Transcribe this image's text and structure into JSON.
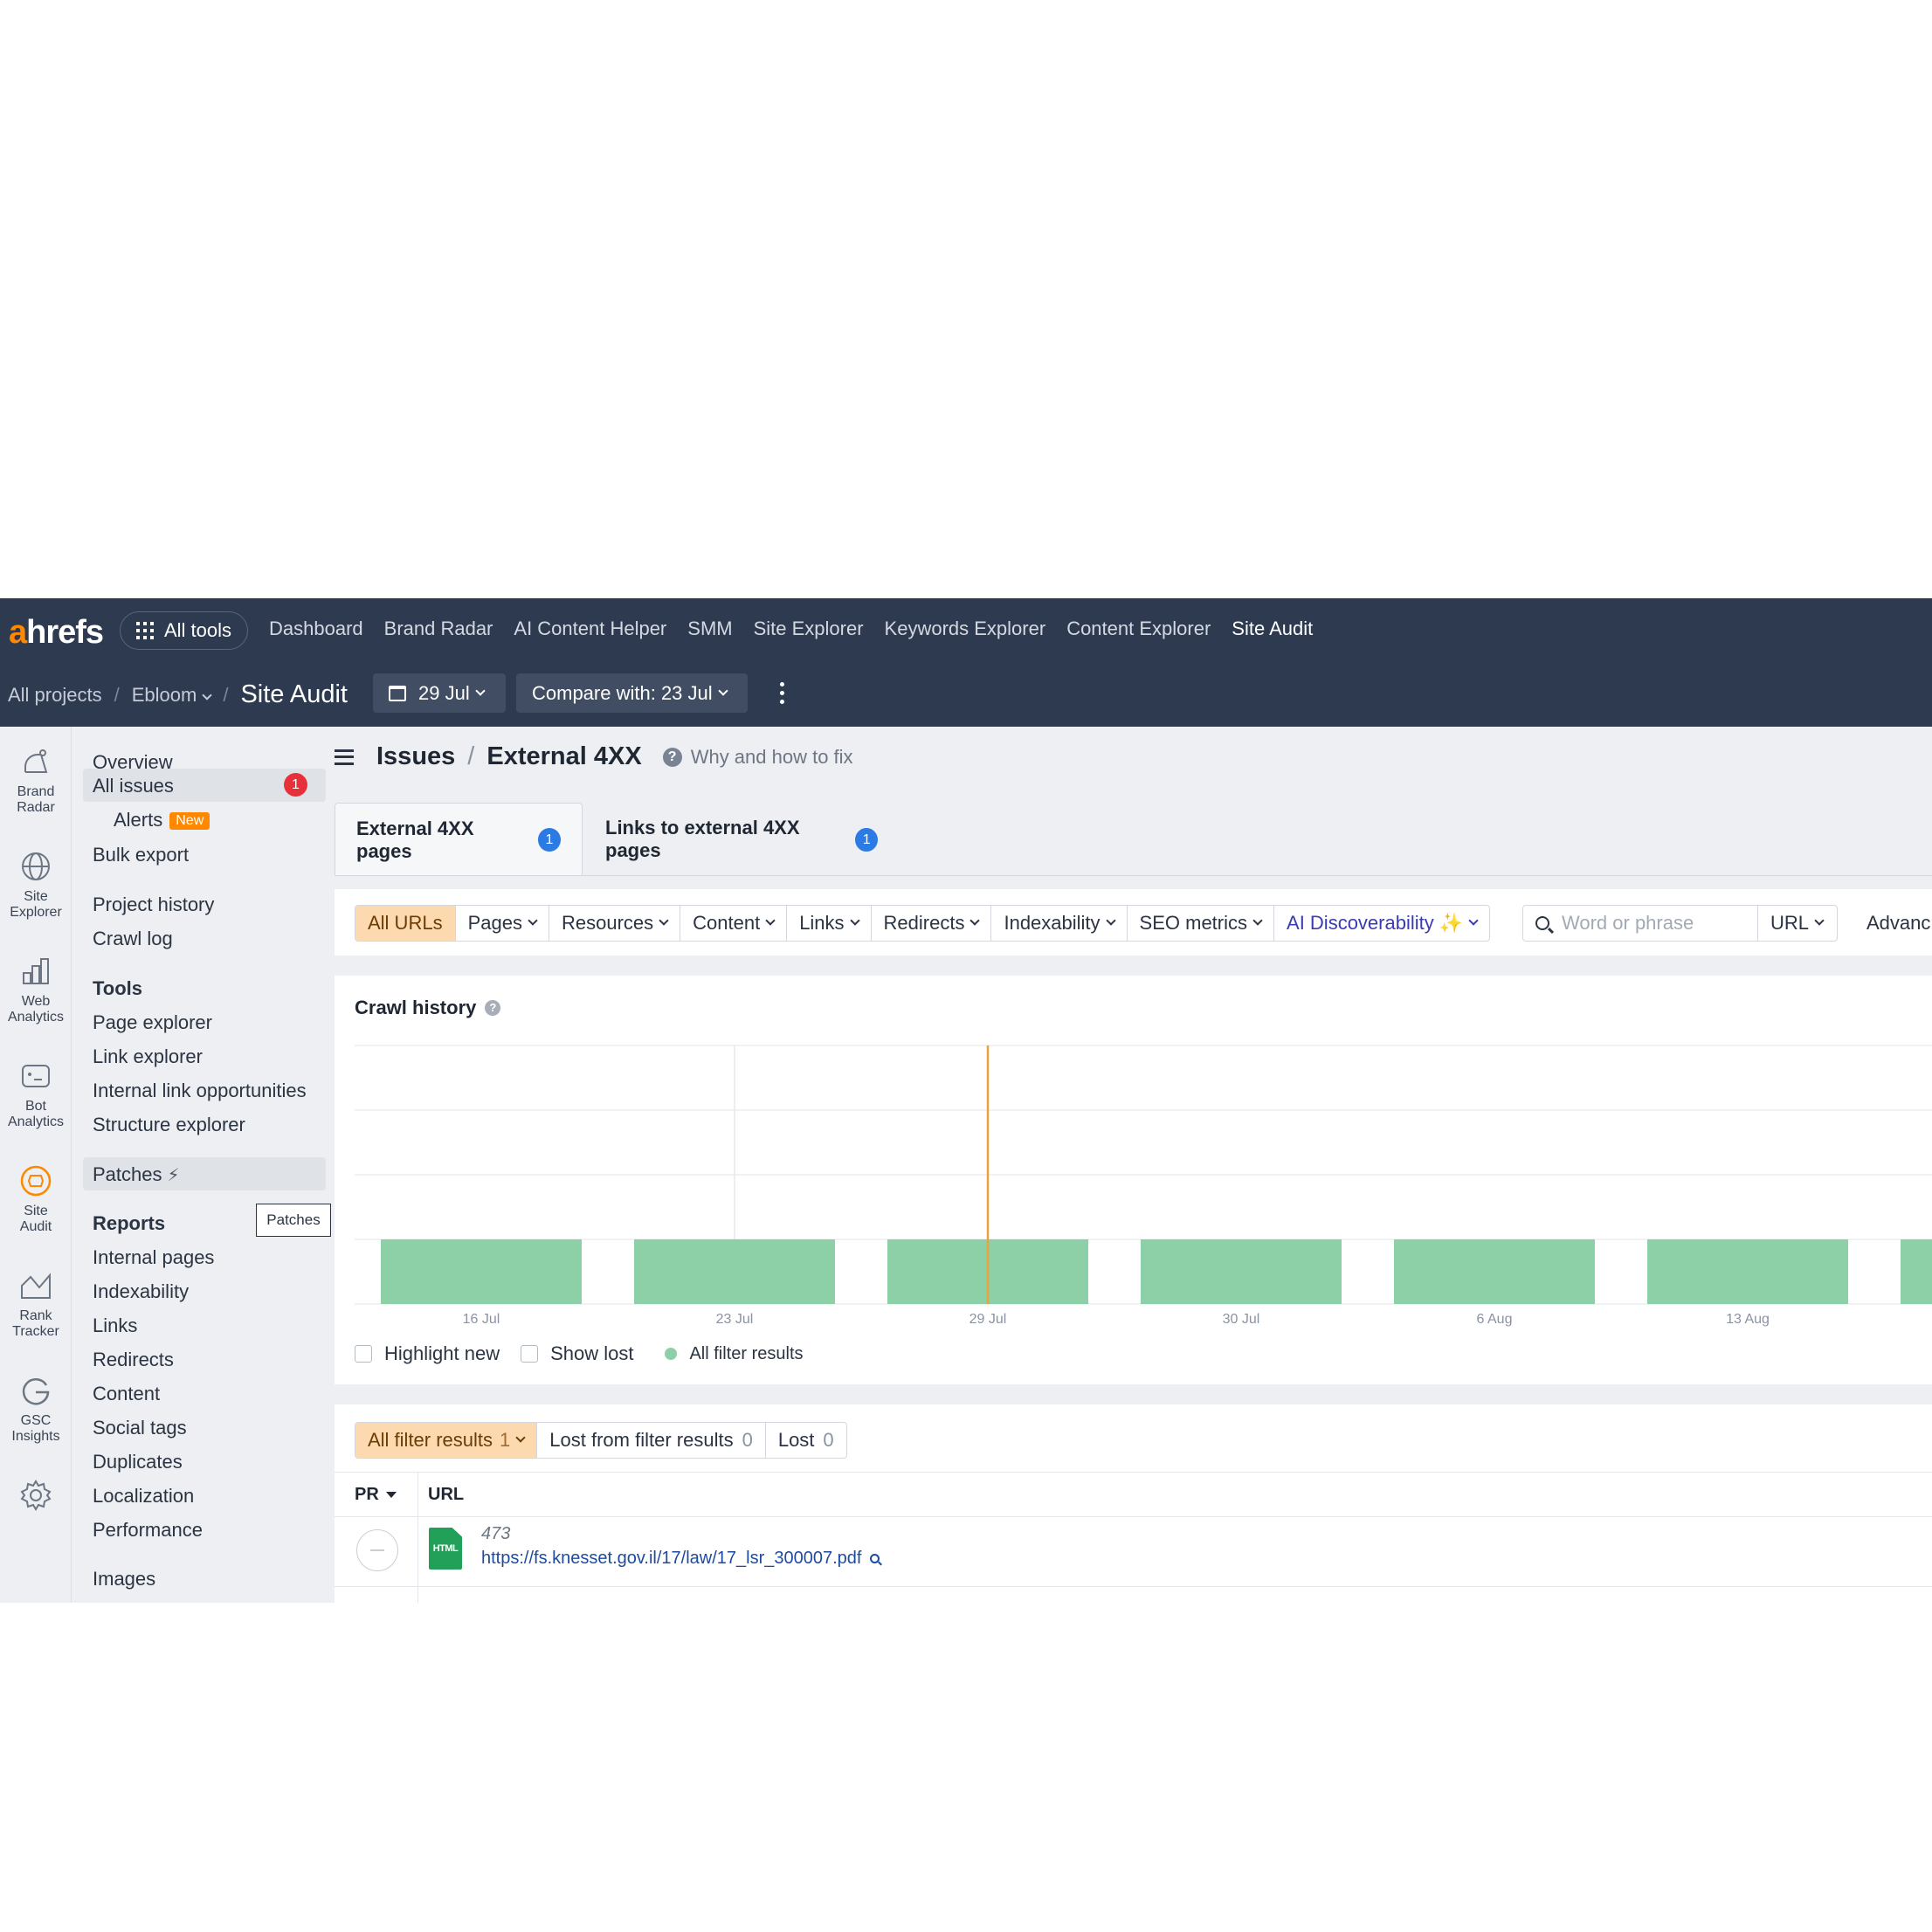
{
  "topnav": {
    "logo_accent": "a",
    "logo_rest": "hrefs",
    "all_tools": "All tools",
    "links": [
      "Dashboard",
      "Brand Radar",
      "AI Content Helper",
      "SMM",
      "Site Explorer",
      "Keywords Explorer",
      "Content Explorer",
      "Site Audit"
    ],
    "active_link": "Site Audit"
  },
  "subnav": {
    "all_projects": "All projects",
    "project": "Ebloom",
    "title": "Site Audit",
    "date": "29 Jul",
    "compare": "Compare with: 23 Jul"
  },
  "rail": [
    {
      "label1": "Brand",
      "label2": "Radar",
      "icon": "brand-radar-icon"
    },
    {
      "label1": "Site",
      "label2": "Explorer",
      "icon": "globe-icon"
    },
    {
      "label1": "Web",
      "label2": "Analytics",
      "icon": "bar-chart-icon"
    },
    {
      "label1": "Bot",
      "label2": "Analytics",
      "icon": "bot-icon"
    },
    {
      "label1": "Site",
      "label2": "Audit",
      "icon": "site-audit-icon"
    },
    {
      "label1": "Rank",
      "label2": "Tracker",
      "icon": "rank-tracker-icon"
    },
    {
      "label1": "GSC",
      "label2": "Insights",
      "icon": "google-icon"
    }
  ],
  "sidebar": {
    "overview": "Overview",
    "all_issues": "All issues",
    "all_issues_count": "1",
    "alerts": "Alerts",
    "new_badge": "New",
    "bulk_export": "Bulk export",
    "project_history": "Project history",
    "crawl_log": "Crawl log",
    "tools_heading": "Tools",
    "tools": [
      "Page explorer",
      "Link explorer",
      "Internal link opportunities",
      "Structure explorer"
    ],
    "patches": "Patches",
    "reports_heading": "Reports",
    "tooltip": "Patches",
    "reports": [
      "Internal pages",
      "Indexability",
      "Links",
      "Redirects",
      "Content",
      "Social tags",
      "Duplicates",
      "Localization",
      "Performance",
      "Images"
    ]
  },
  "header": {
    "section": "Issues",
    "issue": "External 4XX",
    "why_fix": "Why and how to fix"
  },
  "tabs": [
    {
      "label": "External 4XX pages",
      "count": "1"
    },
    {
      "label": "Links to external 4XX pages",
      "count": "1"
    }
  ],
  "filters": {
    "segments": [
      "All URLs",
      "Pages",
      "Resources",
      "Content",
      "Links",
      "Redirects",
      "Indexability",
      "SEO metrics",
      "AI Discoverability"
    ],
    "search_placeholder": "Word or phrase",
    "search_scope": "URL",
    "advanced": "Advanc"
  },
  "chart": {
    "title": "Crawl history",
    "legend": {
      "highlight_new": "Highlight new",
      "show_lost": "Show lost",
      "all_filter_results": "All filter results"
    }
  },
  "chart_data": {
    "type": "bar",
    "categories": [
      "16 Jul",
      "23 Jul",
      "29 Jul",
      "30 Jul",
      "6 Aug",
      "13 Aug"
    ],
    "values": [
      1,
      1,
      1,
      1,
      1,
      1
    ],
    "ylim": [
      0,
      4
    ],
    "grid": true,
    "highlighted_category": "29 Jul",
    "bar_color": "#8dcfa6",
    "marker_color": "#e8a33d"
  },
  "results": {
    "segments": [
      {
        "label": "All filter results",
        "count": "1"
      },
      {
        "label": "Lost from filter results",
        "count": "0"
      },
      {
        "label": "Lost",
        "count": "0"
      }
    ],
    "columns": [
      "PR",
      "URL"
    ],
    "rows": [
      {
        "title": "473",
        "url": "https://fs.knesset.gov.il/17/law/17_lsr_300007.pdf",
        "file_type": "HTML"
      }
    ]
  }
}
